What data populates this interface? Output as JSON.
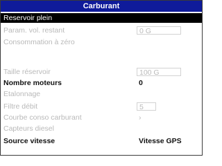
{
  "title": "Carburant",
  "rows": [
    {
      "label": "Reservoir plein"
    },
    {
      "label": "Param. vol. restant",
      "value": "0 G"
    },
    {
      "label": "Consommation à zéro"
    },
    {
      "label": "Taille réservoir",
      "value": "100 G"
    },
    {
      "label": "Nombre moteurs",
      "value": "0"
    },
    {
      "label": "Etalonnage"
    },
    {
      "label": "Filtre débit",
      "value": "5"
    },
    {
      "label": "Courbe conso carburant",
      "value": "›"
    },
    {
      "label": "Capteurs diesel"
    },
    {
      "label": "Source vitesse",
      "value": "Vitesse GPS"
    }
  ]
}
